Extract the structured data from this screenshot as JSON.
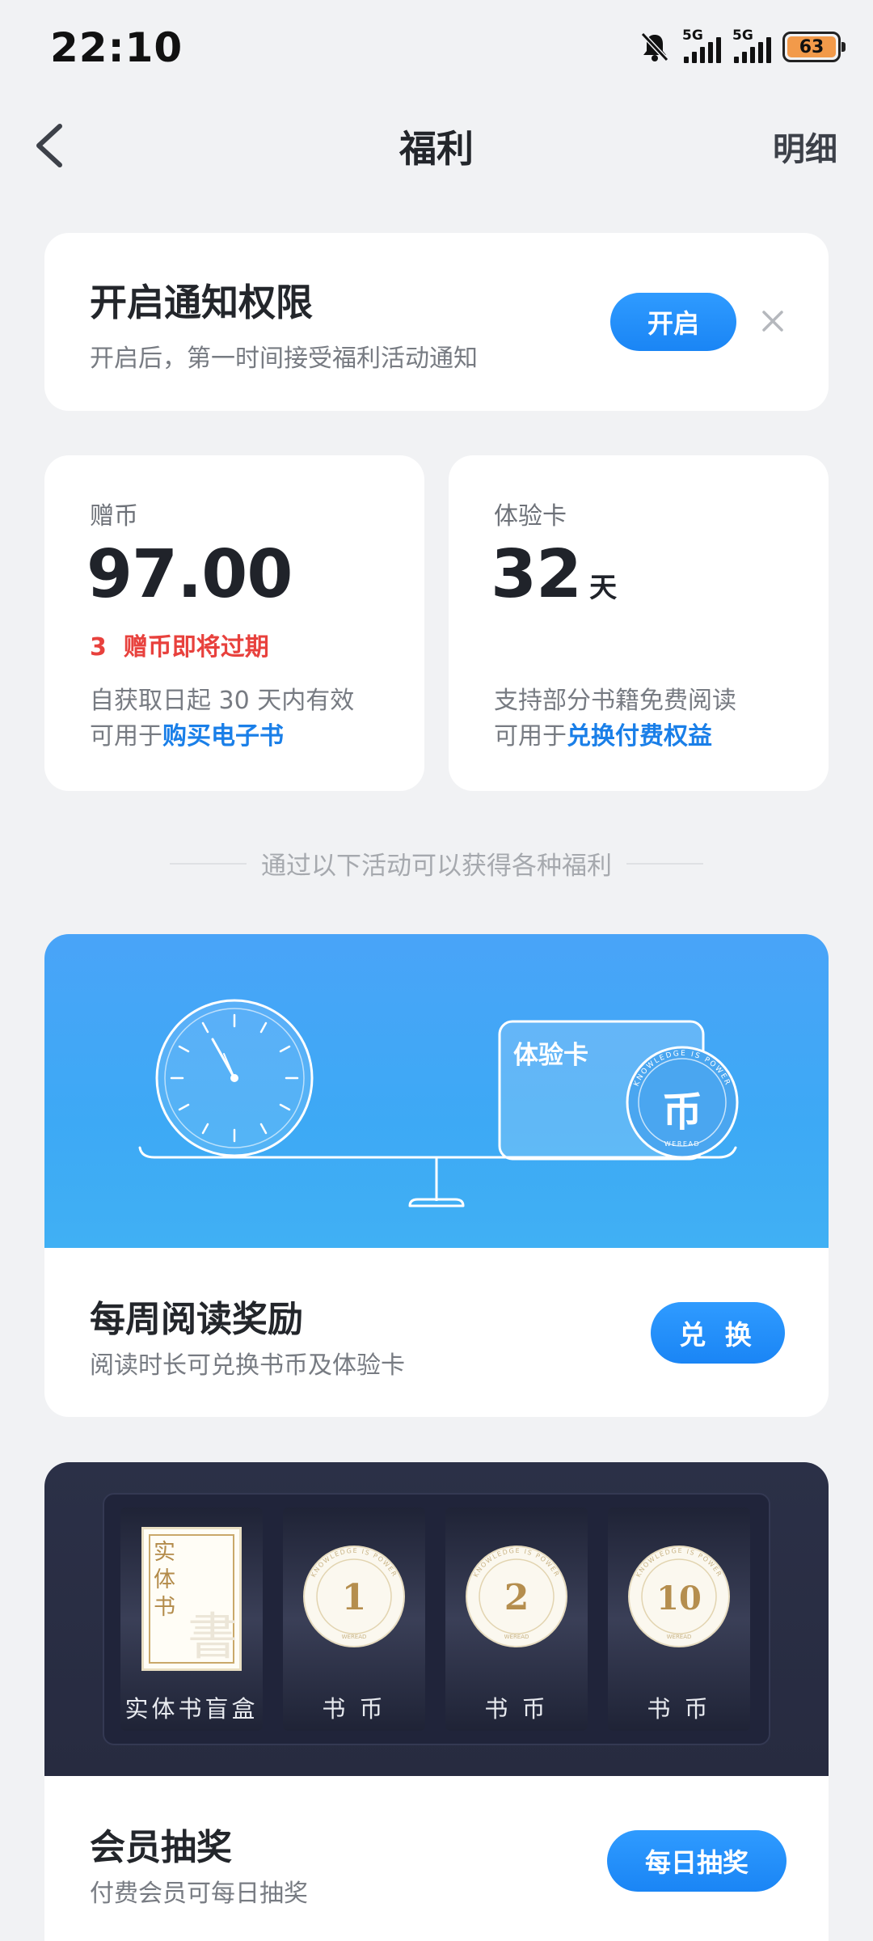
{
  "status_bar": {
    "time": "22:10",
    "network1": "5G",
    "network2": "5G",
    "battery": "63",
    "icons": [
      "bell-muted-icon",
      "signal-icon",
      "signal-icon",
      "battery-icon"
    ]
  },
  "nav": {
    "title": "福利",
    "detail": "明细",
    "back_icon": "chevron-left-icon"
  },
  "notification": {
    "title": "开启通知权限",
    "subtitle": "开启后，第一时间接受福利活动通知",
    "button": "开启",
    "close_icon": "close-icon"
  },
  "coins": {
    "label": "赠币",
    "value": "97.00",
    "expire_count": "3",
    "expire_text": "赠币即将过期",
    "desc_prefix": "自获取日起 ",
    "desc_days": "30",
    "desc_suffix": " 天内有效",
    "use_prefix": "可用于",
    "use_link": "购买电子书"
  },
  "trial_card": {
    "label": "体验卡",
    "value": "32",
    "unit": "天",
    "desc": "支持部分书籍免费阅读",
    "use_prefix": "可用于",
    "use_link": "兑换付费权益"
  },
  "divider_text": "通过以下活动可以获得各种福利",
  "weekly": {
    "banner_card_text": "体验卡",
    "banner_coin_char": "币",
    "coin_ring_top": "KNOWLEDGE IS POWER",
    "coin_ring_bottom": "WEREAD",
    "title": "每周阅读奖励",
    "subtitle": "阅读时长可兑换书币及体验卡",
    "button": "兑 换",
    "colors": {
      "banner": "#49a4f8",
      "button": "#1a85f5"
    }
  },
  "lottery": {
    "book_box_label": "实体书",
    "book_box_watermark": "書",
    "slots": [
      {
        "label": "实体书盲盒"
      },
      {
        "label": "书 币",
        "value": "1"
      },
      {
        "label": "书 币",
        "value": "2"
      },
      {
        "label": "书 币",
        "value": "10"
      }
    ],
    "coin_ring_top": "KNOWLEDGE IS POWER",
    "coin_ring_bottom": "WEREAD",
    "title": "会员抽奖",
    "subtitle": "付费会员可每日抽奖",
    "button": "每日抽奖",
    "colors": {
      "banner": "#2b3047",
      "coin_gold": "#b58e4e"
    }
  }
}
